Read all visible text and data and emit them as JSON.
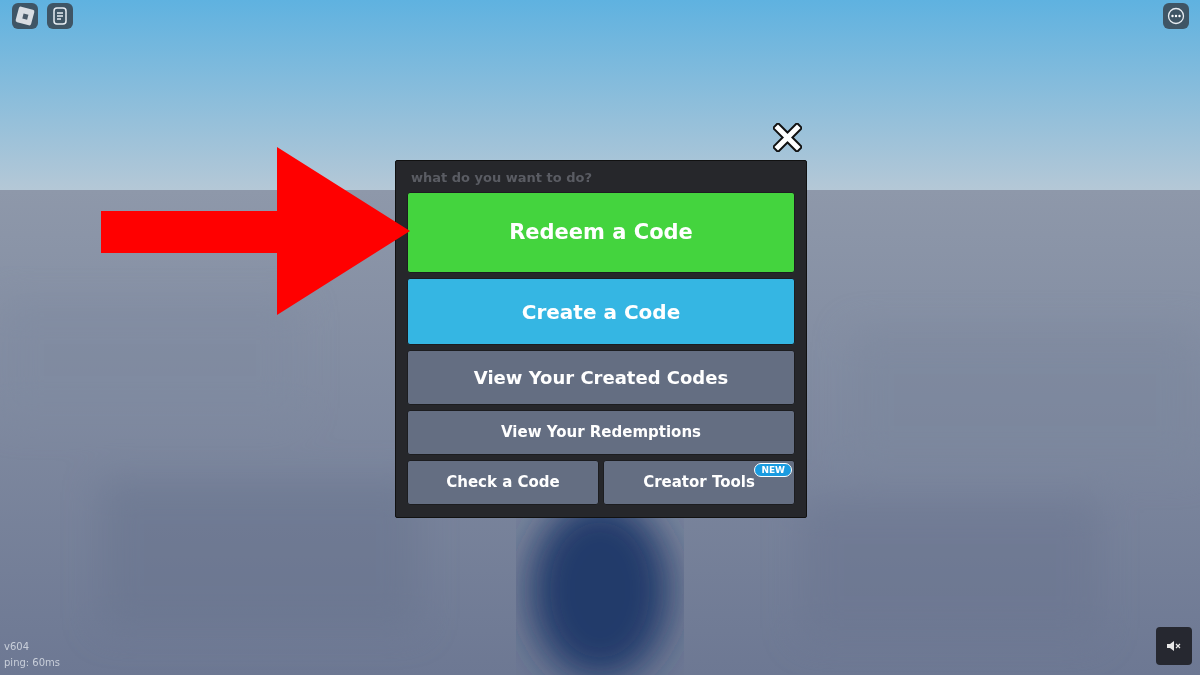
{
  "hud": {
    "version": "v604",
    "ping": "ping: 60ms"
  },
  "dialog": {
    "prompt": "what do you want to do?",
    "rows": [
      [
        {
          "label": "Redeem a Code",
          "color": "#44d43e"
        }
      ],
      [
        {
          "label": "Create a Code",
          "color": "#35b6e3"
        }
      ],
      [
        {
          "label": "View Your Created Codes",
          "color": "#646e82"
        }
      ],
      [
        {
          "label": "View Your Redemptions",
          "color": "#646e82"
        }
      ],
      [
        {
          "label": "Check a Code",
          "color": "#646e82"
        },
        {
          "label": "Creator Tools",
          "color": "#646e82",
          "badge": "NEW"
        }
      ]
    ]
  }
}
